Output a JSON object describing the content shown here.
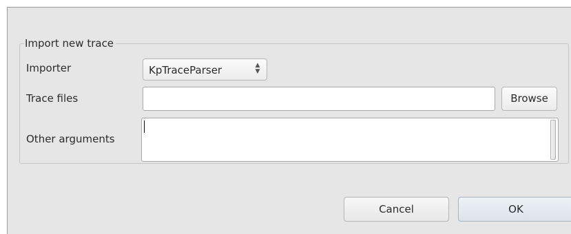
{
  "group": {
    "title": "Import new trace"
  },
  "importer": {
    "label": "Importer",
    "selected": "KpTraceParser",
    "arrows_icon": "updown-arrows-icon"
  },
  "trace_files": {
    "label": "Trace files",
    "value": "",
    "browse_label": "Browse"
  },
  "other_arguments": {
    "label": "Other arguments",
    "value": ""
  },
  "buttons": {
    "cancel_label": "Cancel",
    "ok_label": "OK"
  }
}
